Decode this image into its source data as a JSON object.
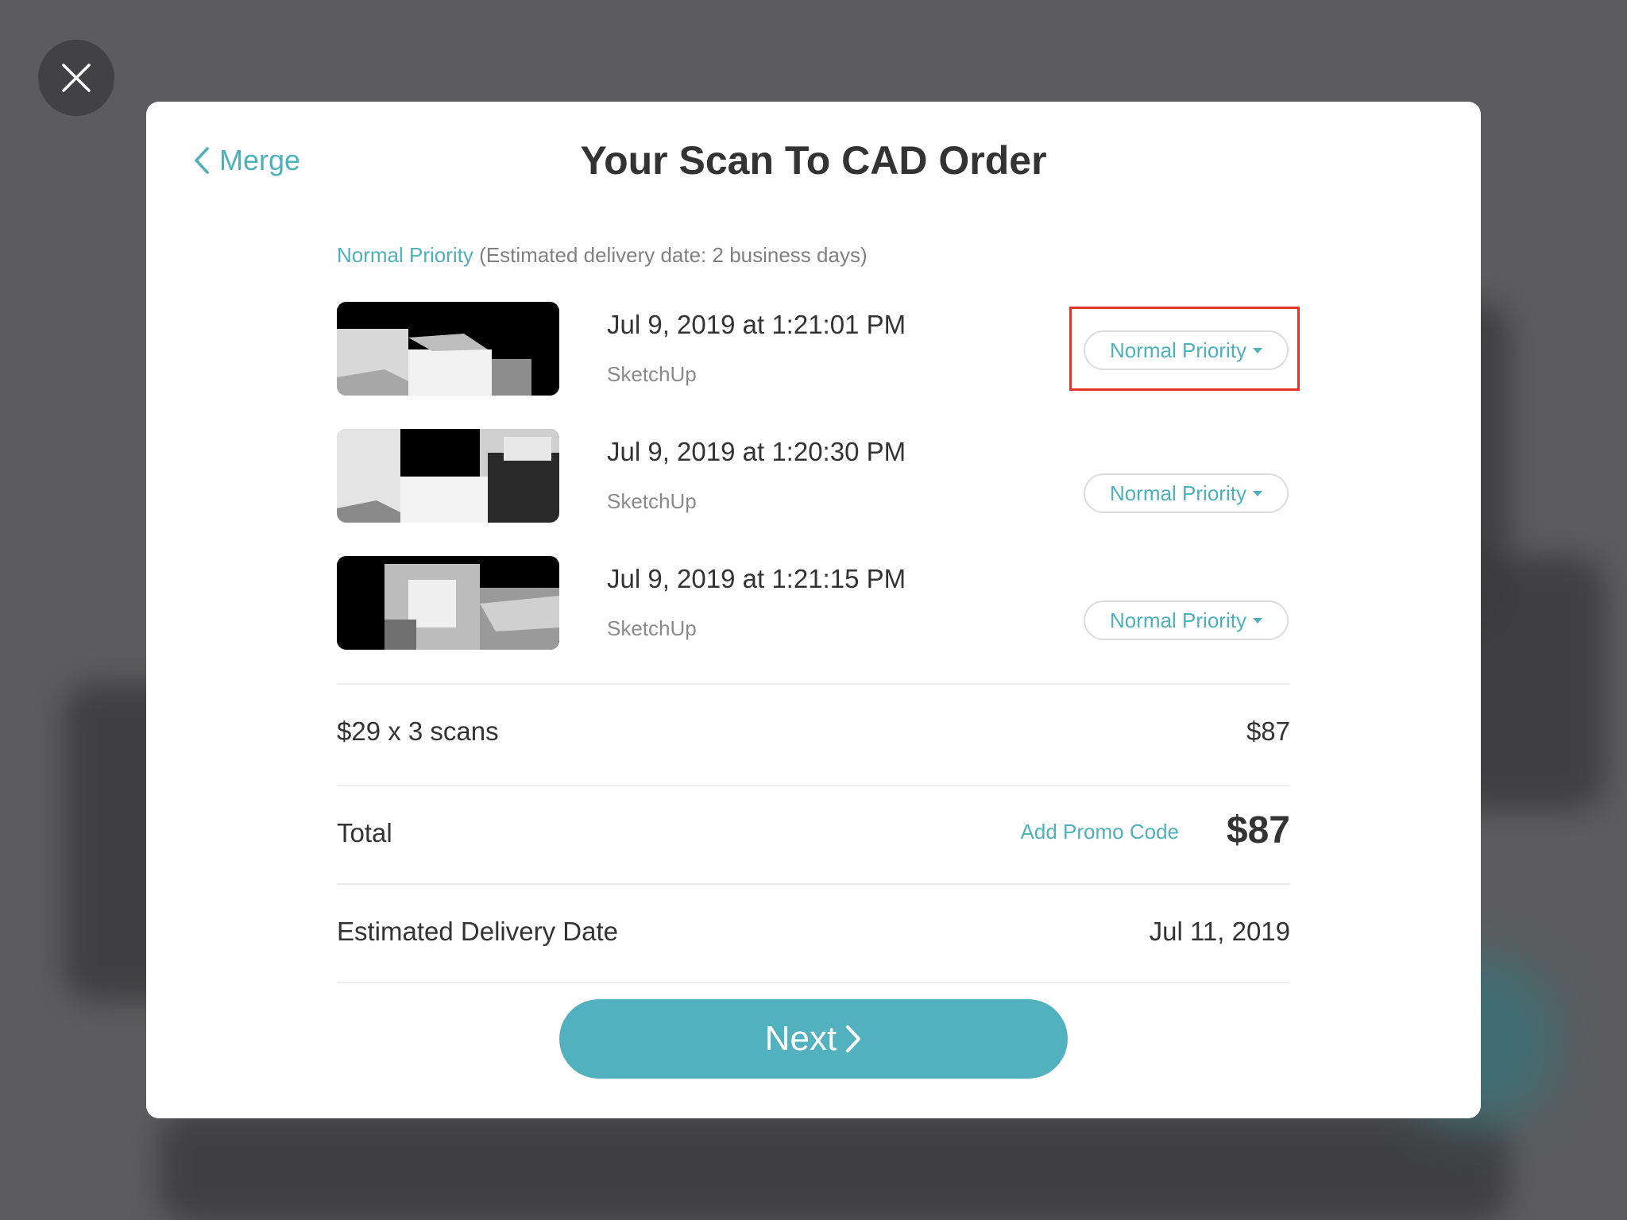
{
  "header": {
    "back_label": "Merge",
    "title": "Your Scan To CAD Order"
  },
  "priority_note": {
    "priority": "Normal Priority",
    "estimate": "(Estimated delivery date: 2 business days)"
  },
  "scans": [
    {
      "date": "Jul 9, 2019 at 1:21:01 PM",
      "app": "SketchUp",
      "priority": "Normal Priority"
    },
    {
      "date": "Jul 9, 2019 at 1:20:30 PM",
      "app": "SketchUp",
      "priority": "Normal Priority"
    },
    {
      "date": "Jul 9, 2019 at 1:21:15 PM",
      "app": "SketchUp",
      "priority": "Normal Priority"
    }
  ],
  "summary": {
    "line_label": "$29 x 3 scans",
    "line_value": "$87",
    "total_label": "Total",
    "promo_label": "Add Promo Code",
    "total_value": "$87",
    "delivery_label": "Estimated Delivery Date",
    "delivery_value": "Jul 11, 2019"
  },
  "actions": {
    "next_label": "Next"
  },
  "icons": {
    "close": "close-icon",
    "back": "chevron-left-icon",
    "next": "chevron-right-icon",
    "dropdown": "caret-down-icon"
  },
  "colors": {
    "accent": "#4db0bb",
    "button": "#52b1bf",
    "highlight": "#e8332a",
    "text": "#333333"
  }
}
